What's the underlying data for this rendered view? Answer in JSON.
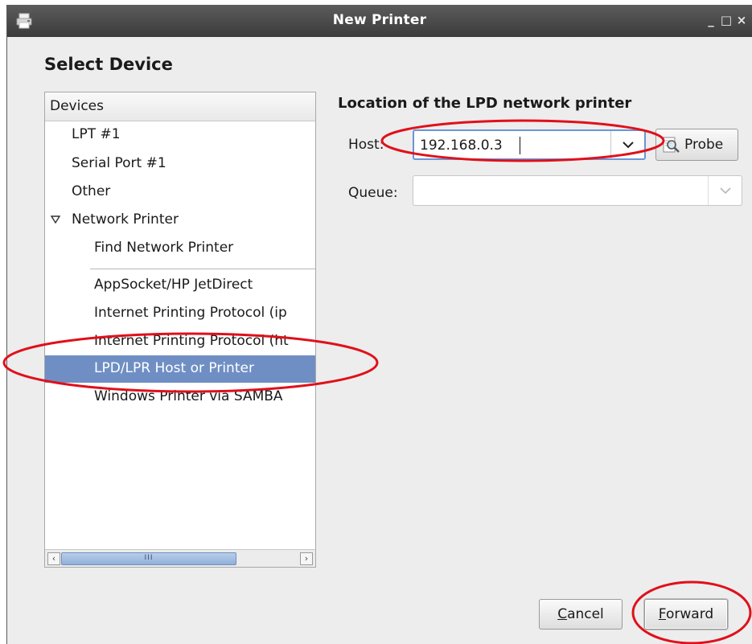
{
  "window": {
    "title": "New Printer",
    "controls": {
      "minimize": "_",
      "maximize": "□",
      "close": "×"
    }
  },
  "page_heading": "Select Device",
  "devices": {
    "header": "Devices",
    "items": [
      {
        "label": "LPT #1",
        "level": 1
      },
      {
        "label": "Serial Port #1",
        "level": 1
      },
      {
        "label": "Other",
        "level": 1
      },
      {
        "label": "Network Printer",
        "level": 1,
        "expanded": true
      },
      {
        "label": "Find Network Printer",
        "level": 2
      },
      {
        "label": "AppSocket/HP JetDirect",
        "level": 2
      },
      {
        "label": "Internet Printing Protocol (ip",
        "level": 2
      },
      {
        "label": "Internet Printing Protocol (ht",
        "level": 2
      },
      {
        "label": "LPD/LPR Host or Printer",
        "level": 2,
        "selected": true
      },
      {
        "label": "Windows Printer via SAMBA",
        "level": 2
      }
    ],
    "scroll_thumb_grip": "III"
  },
  "location": {
    "heading": "Location of the LPD network printer",
    "host_label": "Host:",
    "host_value": "192.168.0.3",
    "queue_label": "Queue:",
    "queue_value": "",
    "probe_label": "Probe"
  },
  "buttons": {
    "cancel": {
      "mnemonic": "C",
      "rest": "ancel"
    },
    "forward": {
      "mnemonic": "F",
      "rest": "orward"
    }
  },
  "colors": {
    "selection": "#6f8fc4",
    "annotation": "#e0101a",
    "titlebar": "#3b3b3b"
  }
}
